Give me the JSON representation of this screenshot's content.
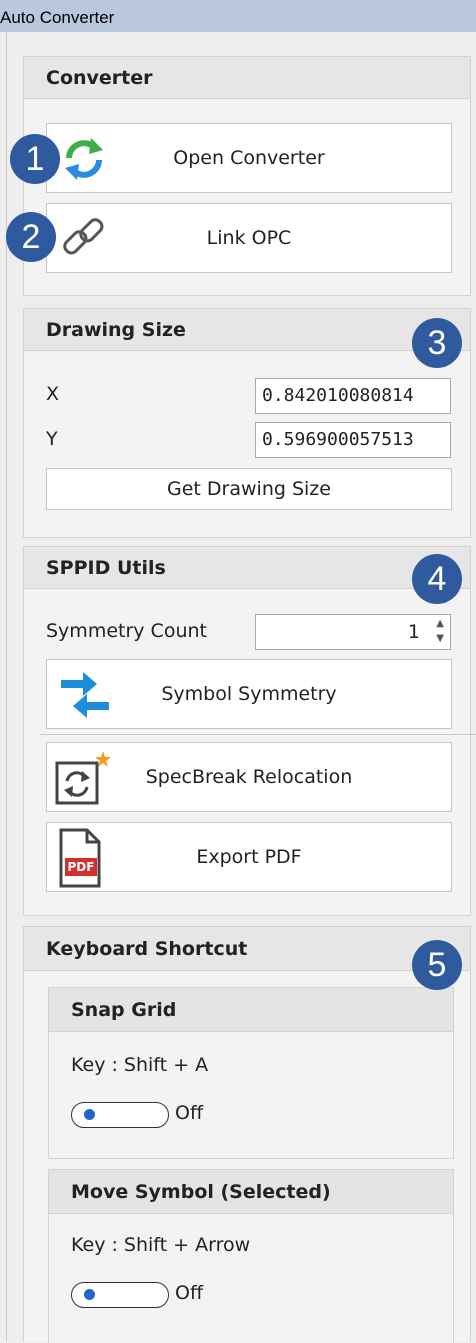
{
  "window": {
    "title": "Auto Converter"
  },
  "converter": {
    "header": "Converter",
    "open_label": "Open Converter",
    "link_label": "Link OPC"
  },
  "drawing": {
    "header": "Drawing Size",
    "x_label": "X",
    "x_value": "0.842010080814",
    "y_label": "Y",
    "y_value": "0.596900057513",
    "get_label": "Get Drawing Size"
  },
  "sppid": {
    "header": "SPPID Utils",
    "symmetry_count_label": "Symmetry Count",
    "symmetry_count_value": "1",
    "symmetry_label": "Symbol Symmetry",
    "specbreak_label": "SpecBreak Relocation",
    "export_label": "Export PDF",
    "pdf_icon_text": "PDF"
  },
  "shortcuts": {
    "header": "Keyboard Shortcut",
    "snap": {
      "title": "Snap Grid",
      "key": "Key : Shift + A",
      "state": "Off"
    },
    "move": {
      "title": "Move Symbol (Selected)",
      "key": "Key : Shift + Arrow",
      "state": "Off"
    }
  },
  "badges": [
    "1",
    "2",
    "3",
    "4",
    "5"
  ],
  "colors": {
    "badge": "#2f5a9e",
    "titlebar": "#b9c8dd",
    "toggle_knob": "#1f67c9",
    "pdf_red": "#d32f2f"
  }
}
